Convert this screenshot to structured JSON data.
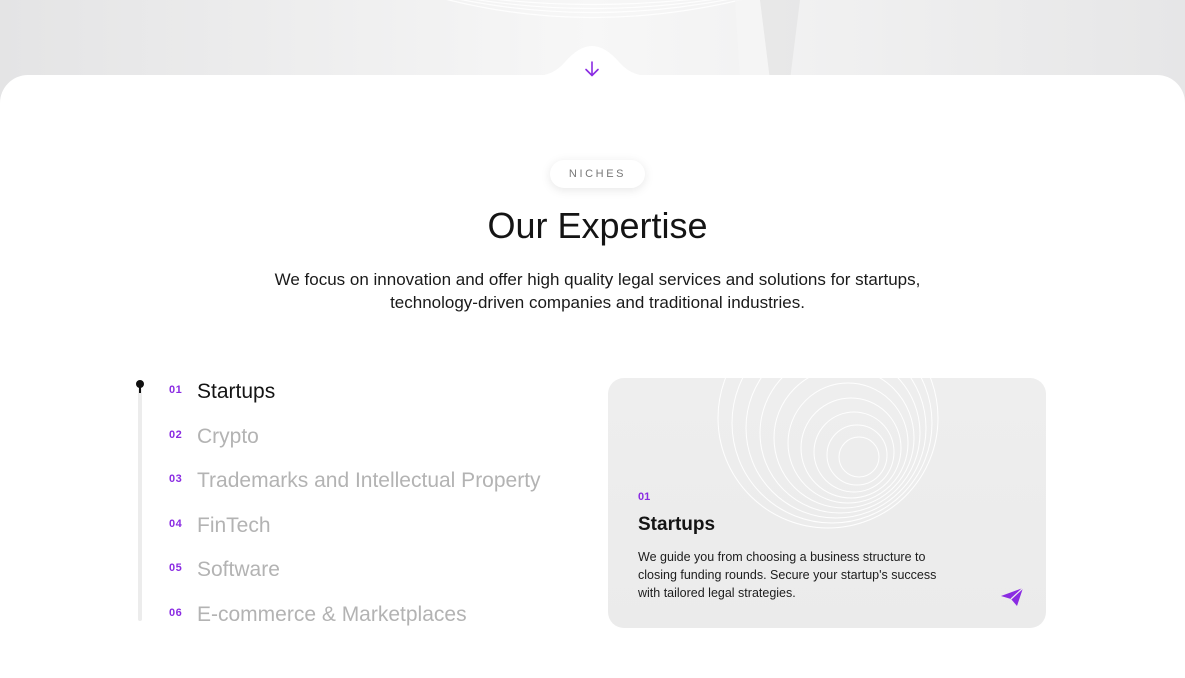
{
  "hero": {
    "scroll_icon": "arrow-down-icon"
  },
  "section": {
    "badge": "NICHES",
    "title": "Our Expertise",
    "subtitle": "We focus on innovation and offer high quality legal services and solutions for startups, technology-driven companies and traditional industries."
  },
  "niches": [
    {
      "num": "01",
      "label": "Startups",
      "active": true
    },
    {
      "num": "02",
      "label": "Crypto",
      "active": false
    },
    {
      "num": "03",
      "label": "Trademarks and Intellectual Property",
      "active": false
    },
    {
      "num": "04",
      "label": "FinTech",
      "active": false
    },
    {
      "num": "05",
      "label": "Software",
      "active": false
    },
    {
      "num": "06",
      "label": "E-commerce & Marketplaces",
      "active": false
    }
  ],
  "card": {
    "num": "01",
    "title": "Startups",
    "text": "We guide you from choosing a business structure to closing funding rounds. Secure your startup's success with tailored legal strategies.",
    "action_icon": "send-icon"
  },
  "colors": {
    "accent": "#8a2be2",
    "text_dark": "#141414",
    "text_muted": "#b3b3b3",
    "card_bg": "#ededed"
  }
}
